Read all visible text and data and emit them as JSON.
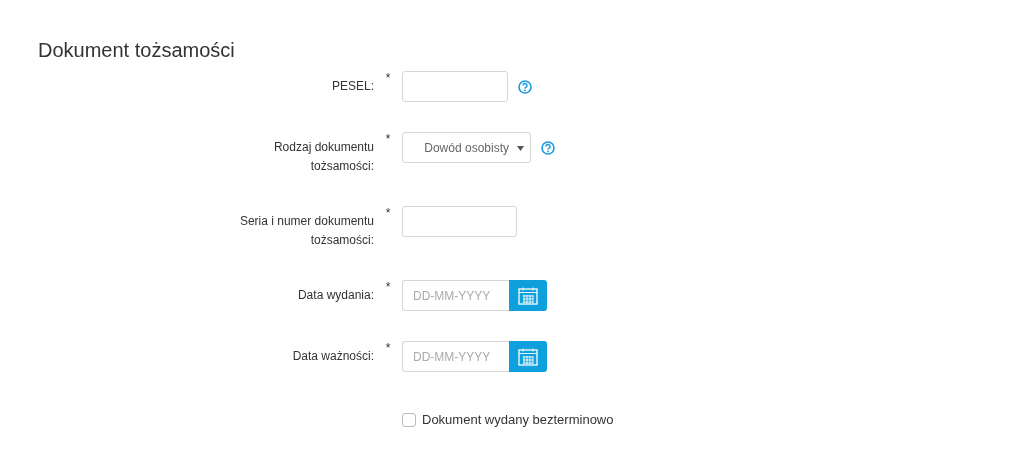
{
  "title": "Dokument tożsamości",
  "fields": [
    {
      "kind": "text",
      "label": "PESEL:",
      "required": "*",
      "help": true
    },
    {
      "kind": "select",
      "label": "Rodzaj dokumentu tożsamości:",
      "required": "*",
      "value": "Dowód osobisty",
      "help": true
    },
    {
      "kind": "text",
      "label": "Seria i numer dokumentu tożsamości:",
      "required": "*",
      "help": false
    },
    {
      "kind": "date",
      "label": "Data wydania:",
      "required": "*",
      "placeholder": "DD-MM-YYYY",
      "help": false
    },
    {
      "kind": "date",
      "label": "Data ważności:",
      "required": "*",
      "placeholder": "DD-MM-YYYY",
      "help": false
    }
  ],
  "checkbox": {
    "label": "Dokument wydany bezterminowo",
    "checked": false
  }
}
